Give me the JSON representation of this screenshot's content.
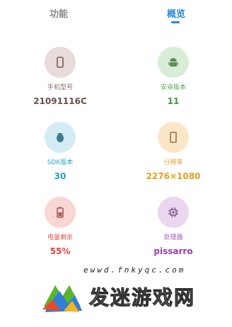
{
  "tabs": [
    {
      "label": "功能"
    },
    {
      "label": "概览"
    }
  ],
  "colors": {
    "accent": "#2a8ad8"
  },
  "items": [
    {
      "label": "手机型号",
      "value": "21091116C",
      "icon": "phone-icon",
      "label_color": "#8a6f6a",
      "value_color": "#6e4e49",
      "bg": "#e8dcda",
      "icon_color": "#7a5a55"
    },
    {
      "label": "安卓版本",
      "value": "11",
      "icon": "android-icon",
      "label_color": "#4caf50",
      "value_color": "#3c9a40",
      "bg": "#d9ecd8",
      "icon_color": "#5b8e59"
    },
    {
      "label": "SDK版本",
      "value": "30",
      "icon": "chip-bug-icon",
      "label_color": "#2ba6c9",
      "value_color": "#2a9cc0",
      "bg": "#d3ecf4",
      "icon_color": "#3f7a8f"
    },
    {
      "label": "分辨率",
      "value": "2276×1080",
      "icon": "screen-icon",
      "label_color": "#e0a13a",
      "value_color": "#e3a020",
      "bg": "#fbe6c8",
      "icon_color": "#a07038"
    },
    {
      "label": "电量剩余",
      "value": "55%",
      "icon": "battery-icon",
      "label_color": "#e0564e",
      "value_color": "#e0453e",
      "bg": "#f9d6d3",
      "icon_color": "#a65a55"
    },
    {
      "label": "处理器",
      "value": "pissarro",
      "icon": "cpu-icon",
      "label_color": "#a55bbf",
      "value_color": "#9a3fb5",
      "bg": "#ead6ef",
      "icon_color": "#7c5486"
    }
  ],
  "watermark": {
    "url": "ewwd.fnkyqc.com",
    "text": "发迷游戏网"
  }
}
